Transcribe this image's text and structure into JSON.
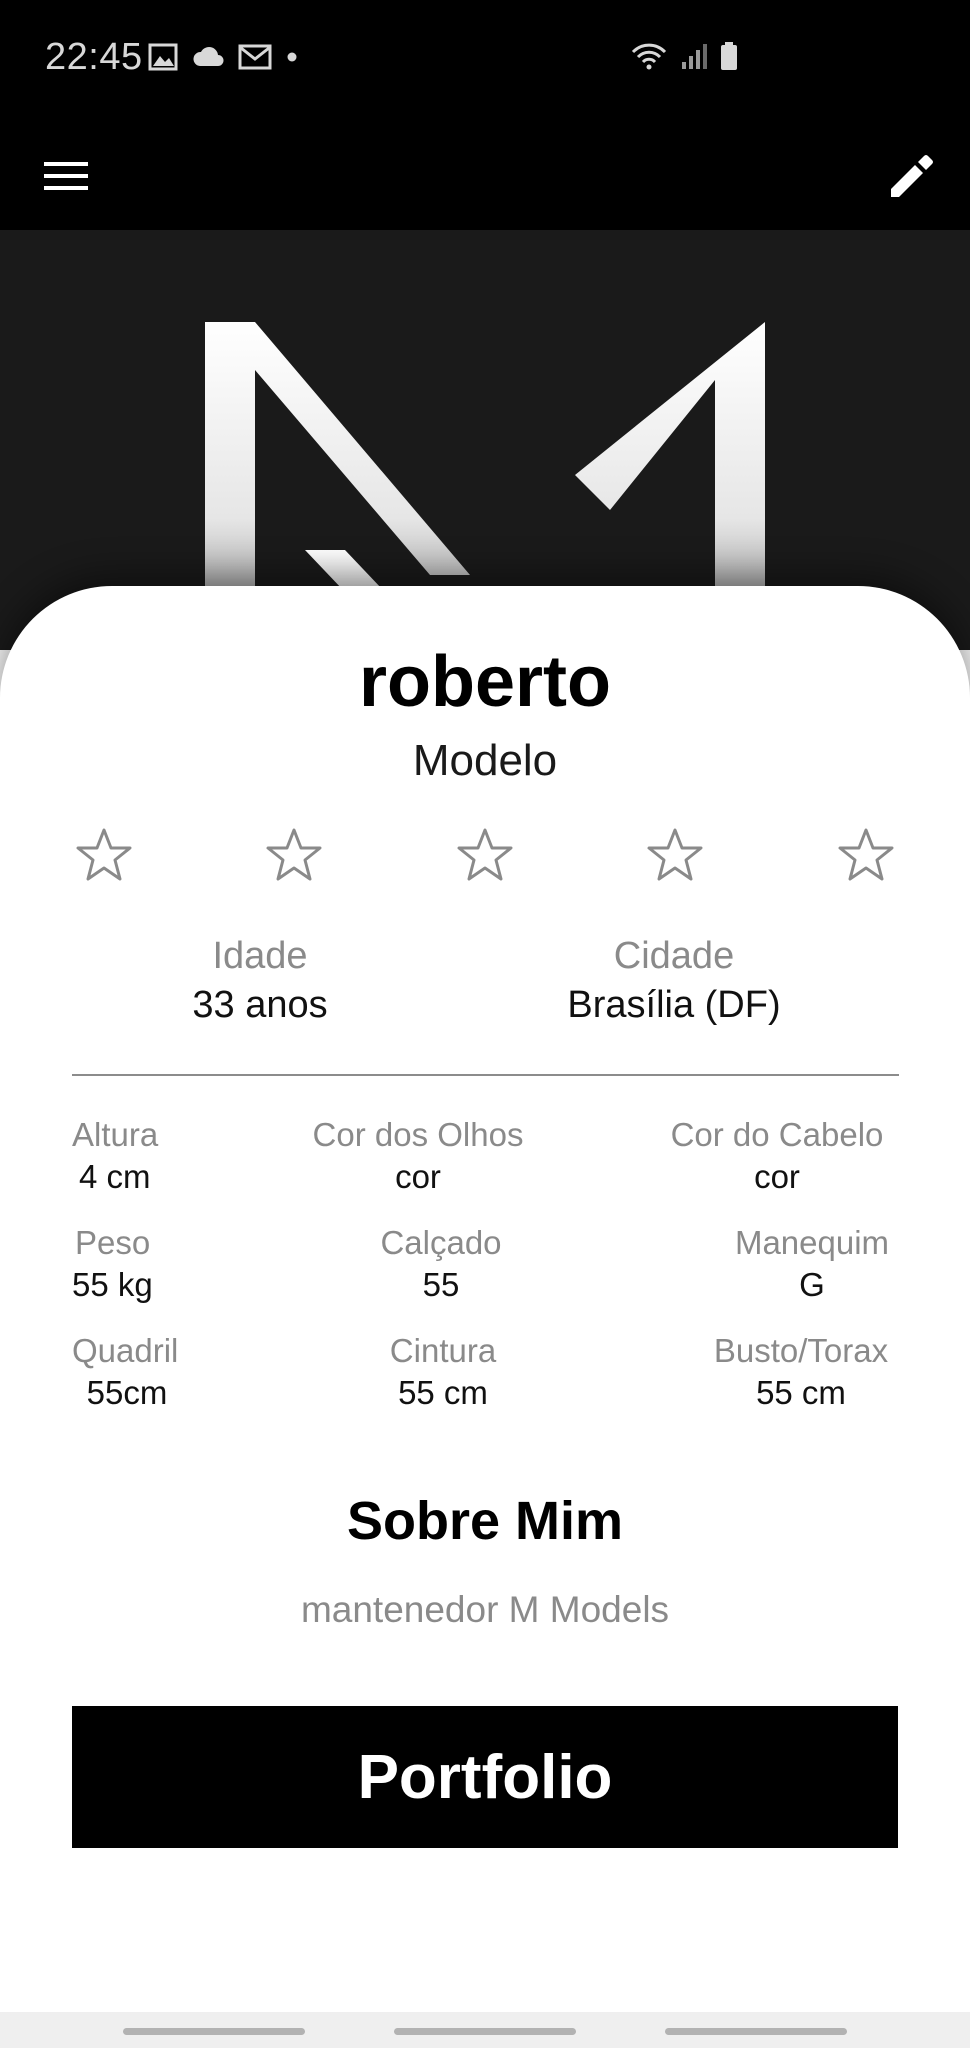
{
  "status_bar": {
    "time": "22:45",
    "left_icons": [
      "image-icon",
      "cloud-icon",
      "mail-icon",
      "dot-icon"
    ],
    "right_icons": [
      "wifi-icon",
      "signal-icon",
      "battery-icon"
    ]
  },
  "app_bar": {
    "menu_icon": "menu-icon",
    "edit_icon": "edit-icon"
  },
  "hero": {
    "logo": "M Models logo"
  },
  "profile": {
    "name": "roberto",
    "role": "Modelo",
    "rating": 0,
    "rating_max": 5
  },
  "info": {
    "age_label": "Idade",
    "age_value": "33 anos",
    "city_label": "Cidade",
    "city_value": "Brasília (DF)"
  },
  "attributes": [
    {
      "label": "Altura",
      "value": "4 cm"
    },
    {
      "label": "Cor dos Olhos",
      "value": "cor"
    },
    {
      "label": "Cor do Cabelo",
      "value": "cor"
    },
    {
      "label": "Peso",
      "value": "55 kg"
    },
    {
      "label": "Calçado",
      "value": "55"
    },
    {
      "label": "Manequim",
      "value": "G"
    },
    {
      "label": "Quadril",
      "value": "55cm"
    },
    {
      "label": "Cintura",
      "value": "55 cm"
    },
    {
      "label": "Busto/Torax",
      "value": "55 cm"
    }
  ],
  "about": {
    "title": "Sobre Mim",
    "text": "mantenedor M Models"
  },
  "portfolio_button": "Portfolio",
  "colors": {
    "app_bar": "#000000",
    "hero_bg": "#1a1a1a",
    "card_bg": "#ffffff",
    "label_gray": "#8a8a8a",
    "button_bg": "#000000"
  }
}
